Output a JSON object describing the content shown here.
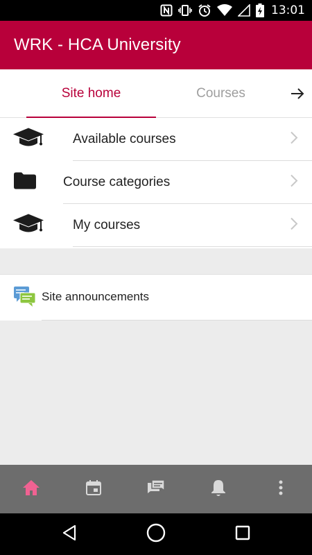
{
  "status_bar": {
    "time": "13:01",
    "icons": [
      "nfc-icon",
      "vibrate-icon",
      "alarm-icon",
      "wifi-icon",
      "signal-icon",
      "battery-charging-icon"
    ]
  },
  "app_bar": {
    "title": "WRK - HCA University"
  },
  "tabs": [
    {
      "label": "Site home",
      "active": true
    },
    {
      "label": "Courses",
      "active": false
    }
  ],
  "tabs_next_icon": "arrow-right-icon",
  "menu": {
    "items": [
      {
        "label": "Available courses",
        "icon": "graduation-cap-icon"
      },
      {
        "label": "Course categories",
        "icon": "folder-icon"
      },
      {
        "label": "My courses",
        "icon": "graduation-cap-icon"
      }
    ]
  },
  "announcements": {
    "label": "Site announcements",
    "icon": "chat-bubbles-icon"
  },
  "bottom_nav": [
    {
      "name": "home",
      "icon": "home-icon",
      "active": true
    },
    {
      "name": "calendar",
      "icon": "calendar-icon",
      "active": false
    },
    {
      "name": "messages",
      "icon": "messages-icon",
      "active": false
    },
    {
      "name": "notifications",
      "icon": "bell-icon",
      "active": false
    },
    {
      "name": "more",
      "icon": "more-vert-icon",
      "active": false
    }
  ],
  "colors": {
    "brand": "#b8003a",
    "bottom_nav_bg": "#6d6d6d",
    "bottom_nav_active": "#f06292",
    "bottom_nav_inactive": "#d9d9d9"
  }
}
